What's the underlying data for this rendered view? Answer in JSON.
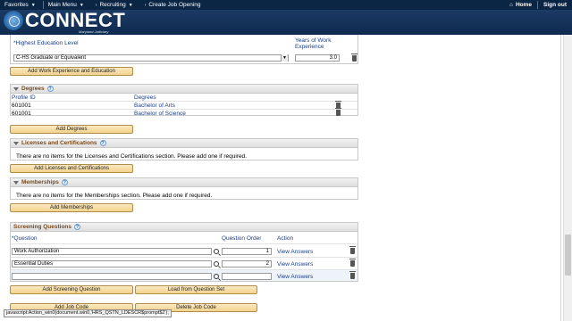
{
  "topnav": {
    "favorites": "Favorites",
    "main_menu": "Main Menu",
    "breadcrumb_1": "Recruiting",
    "breadcrumb_2": "Create Job Opening",
    "home": "Home",
    "sign_out": "Sign out"
  },
  "banner": {
    "title": "CONNECT",
    "subtitle": "Maryland Judiciary"
  },
  "education": {
    "highest_label": "*Highest Education Level",
    "years_label_1": "Years of Work",
    "years_label_2": "Experience",
    "highest_value": "C-HS Graduate or Equivalent",
    "years_value": "3.0",
    "add_button": "Add Work Experience and Education"
  },
  "degrees": {
    "title": "Degrees",
    "col_profile": "Profile ID",
    "col_degrees": "Degrees",
    "rows": [
      {
        "profile_id": "601001",
        "degree": "Bachelor of Arts"
      },
      {
        "profile_id": "601001",
        "degree": "Bachelor of Science"
      }
    ],
    "add_button": "Add Degrees"
  },
  "licenses": {
    "title": "Licenses and Certifications",
    "message": "There are no items for the Licenses and Certifications section.  Please add one if required.",
    "add_button": "Add Licenses and Certifications"
  },
  "memberships": {
    "title": "Memberships",
    "message": "There are no items for the Memberships section.  Please add one if required.",
    "add_button": "Add Memberships"
  },
  "screening": {
    "title": "Screening Questions",
    "col_question": "*Question",
    "col_order": "Question Order",
    "col_action": "Action",
    "rows": [
      {
        "question": "Work Authorization",
        "order": "1",
        "action": "View Answers"
      },
      {
        "question": "Essential Duties",
        "order": "2",
        "action": "View Answers"
      },
      {
        "question": "",
        "order": "",
        "action": "View Answers"
      }
    ],
    "add_button": "Add Screening Question",
    "load_button": "Load from Question Set"
  },
  "job_code": {
    "add_button": "Add Job Code",
    "delete_button": "Delete Job Code"
  },
  "status_bar": "javascript:Action_win0(document.win0,'HRS_QSTN_LDESCR$prompt$2');"
}
